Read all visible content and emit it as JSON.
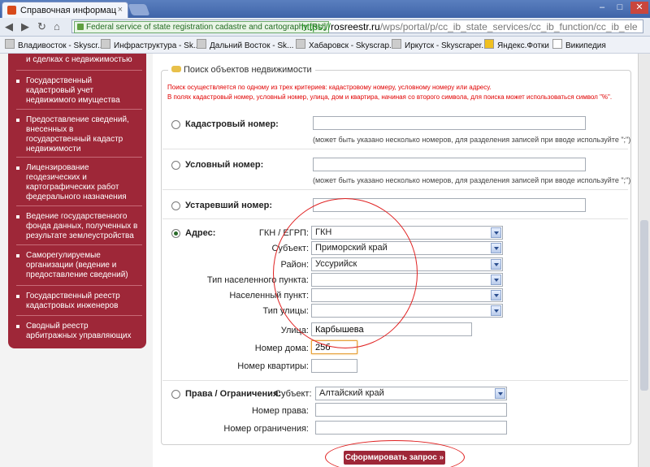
{
  "browser": {
    "tab_title": "Справочная информация п",
    "tab_close": "×",
    "window_controls": [
      "–",
      "□",
      "✕"
    ],
    "security_badge": "Federal service of state registration cadastre and cartography [RU]",
    "url_scheme": "https://",
    "url_host": "rosreestr.ru",
    "url_path": "/wps/portal/p/cc_ib_state_services/cc_ib_function/cc_ib_ele"
  },
  "bookmarks": [
    {
      "label": "Владивосток - Skyscr..."
    },
    {
      "label": "Инфраструктура - Sk..."
    },
    {
      "label": "Дальний Восток - Sk..."
    },
    {
      "label": "Хабаровск - Skyscrap..."
    },
    {
      "label": "Иркутск - Skyscraper..."
    },
    {
      "label": "Яндекс.Фотки"
    },
    {
      "label": "Википедия"
    }
  ],
  "sidebar": {
    "items": [
      {
        "label": "и сделках с недвижимостью"
      },
      {
        "label": "Государственный кадастровый учет недвижимого имущества"
      },
      {
        "label": "Предоставление сведений, внесенных в государственный кадастр недвижимости"
      },
      {
        "label": "Лицензирование геодезических и картографических работ федерального назначения"
      },
      {
        "label": "Ведение государственного фонда данных, полученных в результате землеустройства"
      },
      {
        "label": "Саморегулируемые организации (ведение и предоставление сведений)"
      },
      {
        "label": "Государственный реестр кадастровых инженеров"
      },
      {
        "label": "Сводный реестр арбитражных управляющих"
      }
    ]
  },
  "search": {
    "legend": "Поиск объектов недвижимости",
    "note1": "Поиск осуществляется по одному из трех критериев: кадастровому номеру, условному номеру или адресу.",
    "note2": "В полях кадастровый номер, условный номер, улица, дом и квартира, начиная со второго символа, для поиска может использоваться символ \"%\".",
    "cadastral_label": "Кадастровый номер:",
    "cadastral_hint": "(может быть указано несколько номеров, для разделения записей при вводе используйте \";\")",
    "conditional_label": "Условный номер:",
    "conditional_hint": "(может быть указано несколько номеров, для разделения записей при вводе используйте \";\")",
    "obsolete_label": "Устаревший номер:",
    "address": {
      "label": "Адрес:",
      "gkn_label": "ГКН / ЕГРП:",
      "gkn_value": "ГКН",
      "subject_label": "Субъект:",
      "subject_value": "Приморский край",
      "district_label": "Район:",
      "district_value": "Уссурийск",
      "settlement_type_label": "Тип населенного пункта:",
      "settlement_label": "Населенный пункт:",
      "street_type_label": "Тип улицы:",
      "street_label": "Улица:",
      "street_value": "Карбышева",
      "house_label": "Номер дома:",
      "house_value": "25б",
      "apartment_label": "Номер квартиры:"
    },
    "rights": {
      "label": "Права / Ограничения:",
      "subject_label": "Субъект:",
      "subject_value": "Алтайский край",
      "right_number_label": "Номер права:",
      "restriction_number_label": "Номер ограничения:"
    },
    "selected_criterion": "address",
    "submit_label": "Сформировать запрос »"
  },
  "colors": {
    "sidebar_bg": "#9e2738",
    "warning_text": "#e00000",
    "annotation": "#e02020"
  }
}
